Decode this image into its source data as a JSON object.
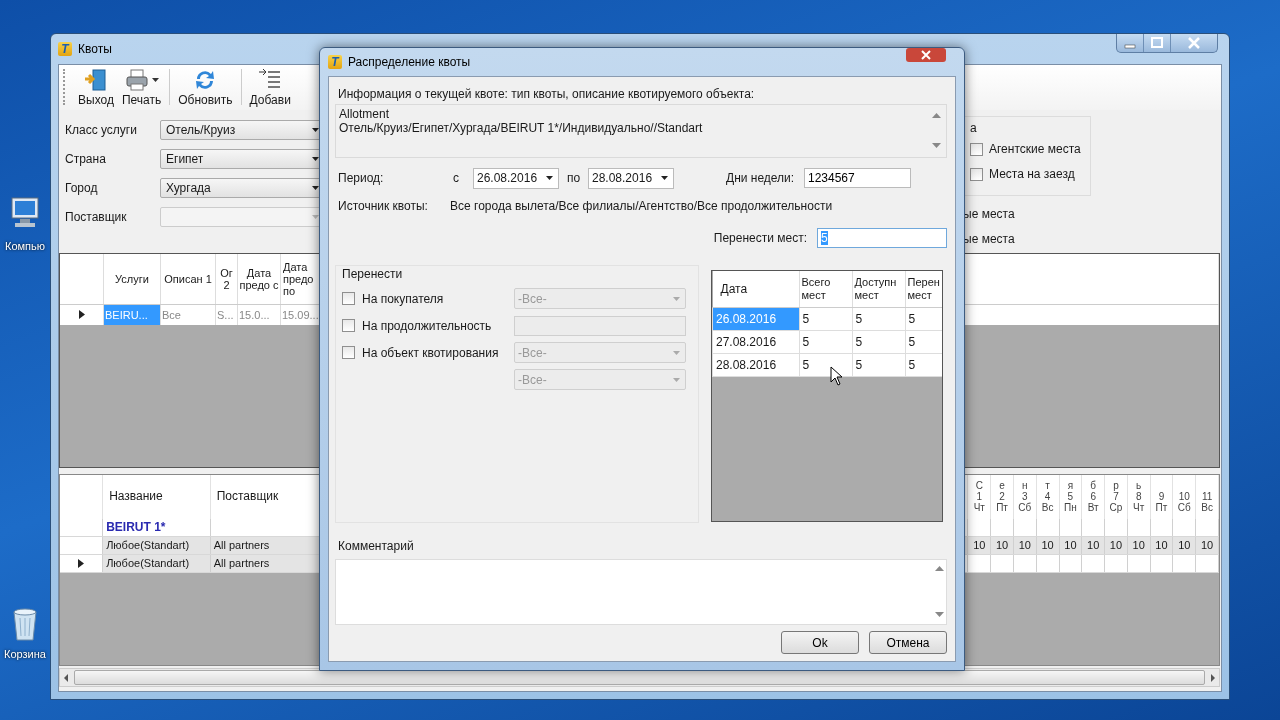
{
  "desktop": {
    "icons": [
      {
        "kind": "computer",
        "label": "Компью"
      },
      {
        "kind": "trash",
        "label": "Корзина"
      }
    ]
  },
  "main_window": {
    "logo": "T",
    "title": "Квоты",
    "toolbar": [
      {
        "kind": "exit",
        "label": "Выход",
        "dropdown": false
      },
      {
        "kind": "print",
        "label": "Печать",
        "dropdown": true
      },
      {
        "kind": "refresh",
        "label": "Обновить",
        "dropdown": false
      },
      {
        "kind": "add",
        "label": "Добави",
        "dropdown": false
      }
    ],
    "filters": [
      {
        "label": "Класс услуги",
        "value": "Отель/Круиз",
        "disabled": false
      },
      {
        "label": "Страна",
        "value": "Египет",
        "disabled": false
      },
      {
        "label": "Город",
        "value": "Хургада",
        "disabled": false
      },
      {
        "label": "Поставщик",
        "disabled": true
      }
    ],
    "options_group": {
      "title": "а",
      "checkboxes": [
        {
          "label": "Агентские места",
          "checked": false
        },
        {
          "label": "Места на заезд",
          "checked": false
        }
      ]
    },
    "option_labels": [
      "ые места",
      "ые места"
    ],
    "quota_table": {
      "columns": [
        "Услуги",
        "Описан 1",
        "Ог 2",
        "Дата предо с",
        "Дата предо по"
      ],
      "rows": [
        {
          "current": true,
          "cells": [
            {
              "text": "BEIRU...",
              "selected": true
            },
            {
              "text": "Все",
              "selected": false
            },
            {
              "text": "S...",
              "selected": false
            },
            {
              "text": "15.0...",
              "selected": false
            },
            {
              "text": "15.09...",
              "selected": false
            }
          ]
        }
      ]
    },
    "hotel_table": {
      "columns": [
        "Название",
        "Поставщик"
      ],
      "day_columns": [
        {
          "month_letter": "С",
          "day": "1",
          "weekday": "Чт"
        },
        {
          "month_letter": "е",
          "day": "2",
          "weekday": "Пт"
        },
        {
          "month_letter": "н",
          "day": "3",
          "weekday": "Сб"
        },
        {
          "month_letter": "т",
          "day": "4",
          "weekday": "Вс"
        },
        {
          "month_letter": "я",
          "day": "5",
          "weekday": "Пн"
        },
        {
          "month_letter": "б",
          "day": "6",
          "weekday": "Вт"
        },
        {
          "month_letter": "р",
          "day": "7",
          "weekday": "Ср"
        },
        {
          "month_letter": "ь",
          "day": "8",
          "weekday": "Чт"
        },
        {
          "day": "9",
          "weekday": "Пт"
        },
        {
          "day": "10",
          "weekday": "Сб"
        },
        {
          "day": "11",
          "weekday": "Вс"
        }
      ],
      "rows": [
        {
          "kind": "hotel",
          "current": false,
          "name": "BEIRUT 1*"
        },
        {
          "kind": "room",
          "current": false,
          "name": "Любое(Standart)",
          "supplier": "All partners",
          "values": [
            "10",
            "10",
            "10",
            "10",
            "10",
            "10",
            "10",
            "10",
            "10",
            "10",
            "10"
          ]
        },
        {
          "kind": "room",
          "current": true,
          "name": "Любое(Standart)",
          "supplier": "All partners"
        }
      ]
    }
  },
  "dialog": {
    "logo": "T",
    "title": "Распределение квоты",
    "info_label": "Информация о текущей квоте: тип квоты, описание квотируемого объекта:",
    "info_lines": [
      "Allotment",
      "Отель/Круиз/Египет/Хургада/BEIRUT 1*/Индивидуально//Standart"
    ],
    "period_label": "Период:",
    "from_label": "с",
    "from_date": "26.08.2016",
    "to_label": "по",
    "to_date": "28.08.2016",
    "weekdays_label": "Дни недели:",
    "weekdays_value": "1234567",
    "source_label": "Источник квоты:",
    "source_value": "Все города вылета/Все филиалы/Агентство/Все продолжительности",
    "transfer_count": {
      "label": "Перенести мест:",
      "value": "5",
      "value_selected": true
    },
    "transfer_group": {
      "title": "Перенести",
      "options": [
        {
          "kind": "combo",
          "label": "На покупателя",
          "checked": false,
          "value": "-Все-"
        },
        {
          "kind": "text",
          "label": "На продолжительность",
          "checked": false
        },
        {
          "kind": "combo",
          "label": "На объект квотирования",
          "checked": false,
          "value": "-Все-"
        },
        {
          "kind": "combo",
          "value": "-Все-"
        }
      ]
    },
    "dates_table": {
      "columns": [
        "Дата",
        "Всего мест",
        "Доступн мест",
        "Перен мест"
      ],
      "rows": [
        {
          "selected": true,
          "cells": [
            "26.08.2016",
            "5",
            "5",
            "5"
          ]
        },
        {
          "selected": false,
          "cells": [
            "27.08.2016",
            "5",
            "5",
            "5"
          ]
        },
        {
          "selected": false,
          "cells": [
            "28.08.2016",
            "5",
            "5",
            "5"
          ]
        }
      ]
    },
    "comment_label": "Комментарий",
    "buttons": [
      "Ok",
      "Отмена"
    ]
  }
}
